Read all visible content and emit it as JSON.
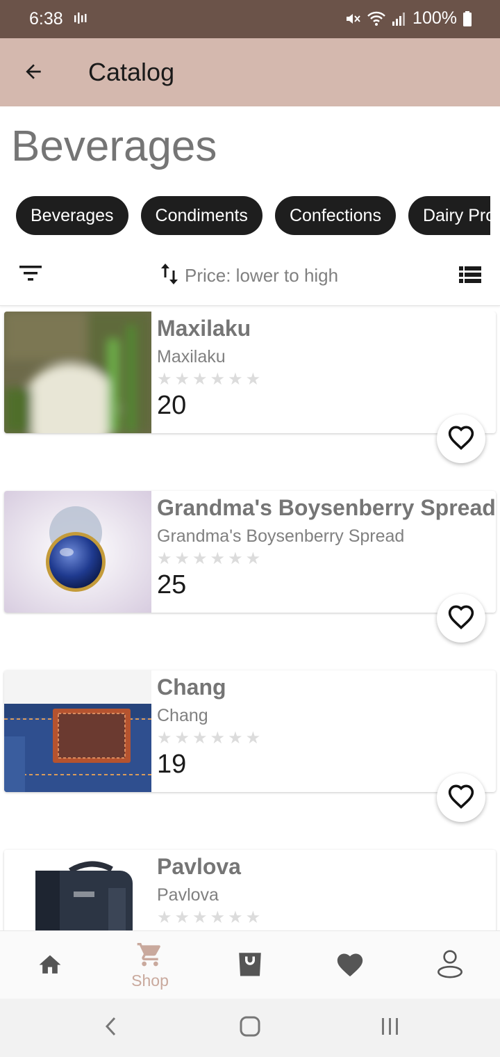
{
  "status_bar": {
    "time": "6:38",
    "battery": "100%"
  },
  "app_bar": {
    "title": "Catalog",
    "back_icon": "arrow-left-icon"
  },
  "header": {
    "category_title": "Beverages",
    "chips": [
      "Beverages",
      "Condiments",
      "Confections",
      "Dairy Products"
    ],
    "sort_label": "Price: lower to high",
    "filter_icon": "filter-icon",
    "sort_icon": "swap-vert-icon",
    "view_icon": "list-view-icon"
  },
  "products": [
    {
      "name": "Maxilaku",
      "subtitle": "Maxilaku",
      "rating": 0,
      "max_rating": 6,
      "price": "20",
      "image": "blurred-plant-photo"
    },
    {
      "name": "Grandma's Boysenberry Spread",
      "subtitle": "Grandma's Boysenberry Spread",
      "rating": 0,
      "max_rating": 6,
      "price": "25",
      "image": "blue-marble-photo"
    },
    {
      "name": "Chang",
      "subtitle": "Chang",
      "rating": 0,
      "max_rating": 6,
      "price": "19",
      "image": "jeans-leather-patch-photo"
    },
    {
      "name": "Pavlova",
      "subtitle": "Pavlova",
      "rating": 0,
      "max_rating": 6,
      "price": "",
      "image": "leather-bag-photo"
    }
  ],
  "bottom_nav": {
    "items": [
      {
        "label": "",
        "icon": "home-icon",
        "active": false
      },
      {
        "label": "Shop",
        "icon": "cart-icon",
        "active": true
      },
      {
        "label": "",
        "icon": "shopping-bag-icon",
        "active": false
      },
      {
        "label": "",
        "icon": "heart-filled-icon",
        "active": false
      },
      {
        "label": "",
        "icon": "person-icon",
        "active": false
      }
    ]
  },
  "colors": {
    "status_bar": "#6b5349",
    "app_bar": "#d4b8ae",
    "chip_bg": "#1e1e1e",
    "accent": "#c9a99d"
  }
}
